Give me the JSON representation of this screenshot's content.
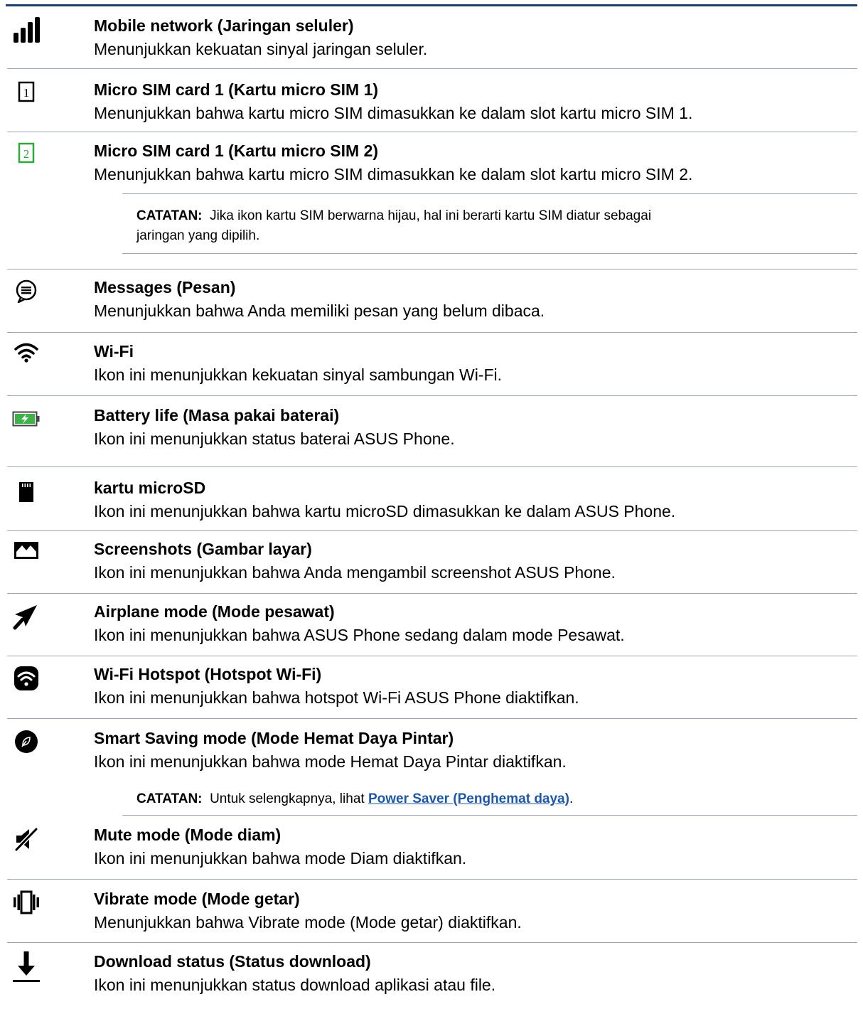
{
  "items": [
    {
      "icon": "signal-bars-icon",
      "title": "Mobile network (Jaringan seluler)",
      "desc": "Menunjukkan kekuatan sinyal jaringan seluler."
    },
    {
      "icon": "sim-card-1-icon",
      "title": "Micro SIM card 1 (Kartu micro SIM 1)",
      "desc": "Menunjukkan bahwa kartu micro SIM dimasukkan ke dalam slot kartu micro SIM 1."
    },
    {
      "icon": "sim-card-2-icon",
      "title": "Micro SIM card 1 (Kartu micro SIM 2)",
      "desc": "Menunjukkan bahwa kartu micro SIM dimasukkan ke dalam slot kartu micro SIM 2."
    },
    {
      "icon": "message-bubble-icon",
      "title": "Messages (Pesan)",
      "desc": "Menunjukkan bahwa Anda memiliki pesan yang belum dibaca."
    },
    {
      "icon": "wifi-icon",
      "title": "Wi-Fi",
      "desc": "Ikon ini menunjukkan kekuatan sinyal sambungan Wi-Fi."
    },
    {
      "icon": "battery-icon",
      "title": "Battery life (Masa pakai baterai)",
      "desc": "Ikon ini menunjukkan status baterai ASUS Phone."
    },
    {
      "icon": "microsd-card-icon",
      "title": "kartu microSD",
      "desc": "Ikon ini menunjukkan bahwa kartu microSD dimasukkan ke dalam ASUS Phone."
    },
    {
      "icon": "screenshot-image-icon",
      "title": "Screenshots (Gambar layar)",
      "desc": "Ikon ini menunjukkan bahwa Anda mengambil screenshot ASUS Phone."
    },
    {
      "icon": "airplane-icon",
      "title": "Airplane mode (Mode pesawat)",
      "desc": "Ikon ini menunjukkan bahwa ASUS Phone sedang dalam mode Pesawat."
    },
    {
      "icon": "wifi-hotspot-icon",
      "title": "Wi-Fi Hotspot (Hotspot Wi-Fi)",
      "desc": "Ikon ini menunjukkan bahwa hotspot Wi-Fi ASUS Phone diaktifkan."
    },
    {
      "icon": "leaf-circle-icon",
      "title": "Smart Saving mode (Mode Hemat Daya Pintar)",
      "desc": "Ikon ini menunjukkan bahwa mode Hemat Daya Pintar diaktifkan."
    },
    {
      "icon": "mute-icon",
      "title": "Mute mode (Mode diam)",
      "desc": "Ikon ini menunjukkan bahwa mode Diam diaktifkan."
    },
    {
      "icon": "vibrate-icon",
      "title": "Vibrate mode (Mode getar)",
      "desc": "Menunjukkan bahwa Vibrate mode (Mode getar) diaktifkan."
    },
    {
      "icon": "download-arrow-icon",
      "title": "Download status (Status download)",
      "desc": "Ikon ini menunjukkan status download aplikasi atau file."
    }
  ],
  "note1": {
    "label": "CATATAN:",
    "line1": "Jika ikon kartu SIM berwarna hijau, hal ini berarti kartu SIM diatur sebagai",
    "line2": "jaringan yang dipilih."
  },
  "note2": {
    "label": "CATATAN:",
    "text": "Untuk selengkapnya, lihat",
    "link": "Power Saver (Penghemat daya)",
    "after": "."
  },
  "colors": {
    "rule": "#1d3f6e",
    "separator": "#9aa7b7",
    "link": "#1f57a8",
    "sim2": "#2fa83a",
    "battery": "#3fb24a"
  }
}
